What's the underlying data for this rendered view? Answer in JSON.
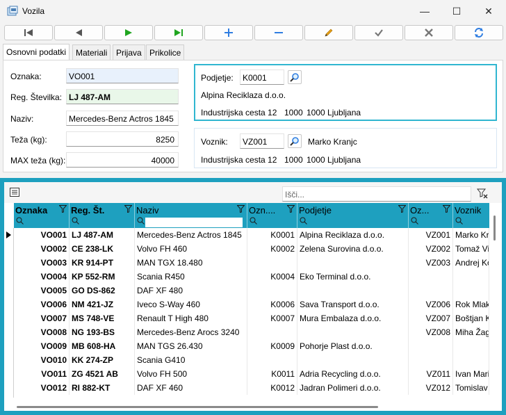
{
  "window": {
    "title": "Vozila",
    "minimize_glyph": "—",
    "maximize_glyph": "☐",
    "close_glyph": "✕"
  },
  "toolbar": {
    "buttons": [
      {
        "name": "first-record-button",
        "icon": "first-icon",
        "color": "#555555"
      },
      {
        "name": "previous-record-button",
        "icon": "previous-icon",
        "color": "#555555"
      },
      {
        "name": "next-record-button",
        "icon": "next-icon",
        "color": "#1fa51f"
      },
      {
        "name": "last-record-button",
        "icon": "last-icon",
        "color": "#1fa51f"
      },
      {
        "name": "add-record-button",
        "icon": "plus-icon",
        "color": "#2f7de1"
      },
      {
        "name": "delete-record-button",
        "icon": "minus-icon",
        "color": "#2f7de1"
      },
      {
        "name": "edit-record-button",
        "icon": "pencil-icon",
        "color": "#e6a117"
      },
      {
        "name": "confirm-button",
        "icon": "check-icon",
        "color": "#777777"
      },
      {
        "name": "cancel-button",
        "icon": "cross-icon",
        "color": "#777777"
      },
      {
        "name": "refresh-button",
        "icon": "refresh-icon",
        "color": "#2f7de1"
      }
    ]
  },
  "tabs": [
    {
      "label": "Osnovni podatki",
      "active": true
    },
    {
      "label": "Materiali",
      "active": false
    },
    {
      "label": "Prijava",
      "active": false
    },
    {
      "label": "Prikolice",
      "active": false
    }
  ],
  "form": {
    "oznaka": {
      "label": "Oznaka:",
      "value": "VO001"
    },
    "reg": {
      "label": "Reg. Številka:",
      "value": "LJ 487-AM"
    },
    "naziv": {
      "label": "Naziv:",
      "value": "Mercedes-Benz Actros 1845"
    },
    "teza": {
      "label": "Teža (kg):",
      "value": "8250"
    },
    "max_teza": {
      "label": "MAX teža (kg):",
      "value": "40000"
    }
  },
  "podjetje": {
    "label": "Podjetje:",
    "code": "K0001",
    "name": "Alpina Reciklaza d.o.o.",
    "street": "Industrijska cesta 12",
    "postal": "1000",
    "city": "1000 Ljubljana"
  },
  "voznik": {
    "label": "Voznik:",
    "code": "VZ001",
    "name": "Marko Kranjc",
    "street": "Industrijska cesta 12",
    "postal": "1000",
    "city": "1000 Ljubljana"
  },
  "grid": {
    "search_placeholder": "Išči...",
    "accent": "#1ea0bf",
    "columns": [
      {
        "label": "Oznaka",
        "bold": true
      },
      {
        "label": "Reg. Št.",
        "bold": true
      },
      {
        "label": "Naziv",
        "bold": false
      },
      {
        "label": "Ozn....",
        "bold": false
      },
      {
        "label": "Podjetje",
        "bold": false
      },
      {
        "label": "Oz...",
        "bold": false
      },
      {
        "label": "Voznik",
        "bold": false
      }
    ],
    "rows": [
      [
        "VO001",
        "LJ 487-AM",
        "Mercedes-Benz Actros 1845",
        "K0001",
        "Alpina Reciklaza d.o.o.",
        "VZ001",
        "Marko Kr"
      ],
      [
        "VO002",
        "CE 238-LK",
        "Volvo FH 460",
        "K0002",
        "Zelena Surovina d.o.o.",
        "VZ002",
        "Tomaž Vi"
      ],
      [
        "VO003",
        "KR 914-PT",
        "MAN TGX 18.480",
        "",
        "",
        "VZ003",
        "Andrej Ko"
      ],
      [
        "VO004",
        "KP 552-RM",
        "Scania R450",
        "K0004",
        "Eko Terminal d.o.o.",
        "",
        ""
      ],
      [
        "VO005",
        "GO DS-862",
        "DAF XF 480",
        "",
        "",
        "",
        ""
      ],
      [
        "VO006",
        "NM 421-JZ",
        "Iveco S-Way 460",
        "K0006",
        "Sava Transport d.o.o.",
        "VZ006",
        "Rok Mlak"
      ],
      [
        "VO007",
        "MS 748-VE",
        "Renault T High 480",
        "K0007",
        "Mura Embalaza d.o.o.",
        "VZ007",
        "Boštjan K"
      ],
      [
        "VO008",
        "NG 193-BS",
        "Mercedes-Benz Arocs 3240",
        "",
        "",
        "VZ008",
        "Miha Žag"
      ],
      [
        "VO009",
        "MB 608-HA",
        "MAN TGS 26.430",
        "K0009",
        "Pohorje Plast d.o.o.",
        "",
        ""
      ],
      [
        "VO010",
        "KK 274-ZP",
        "Scania G410",
        "",
        "",
        "",
        ""
      ],
      [
        "VO011",
        "ZG 4521 AB",
        "Volvo FH 500",
        "K0011",
        "Adria Recycling d.o.o.",
        "VZ011",
        "Ivan Mari"
      ],
      [
        "VO012",
        "RI 882-KT",
        "DAF XF 460",
        "K0012",
        "Jadran Polimeri d.o.o.",
        "VZ012",
        "Tomislav"
      ]
    ]
  }
}
